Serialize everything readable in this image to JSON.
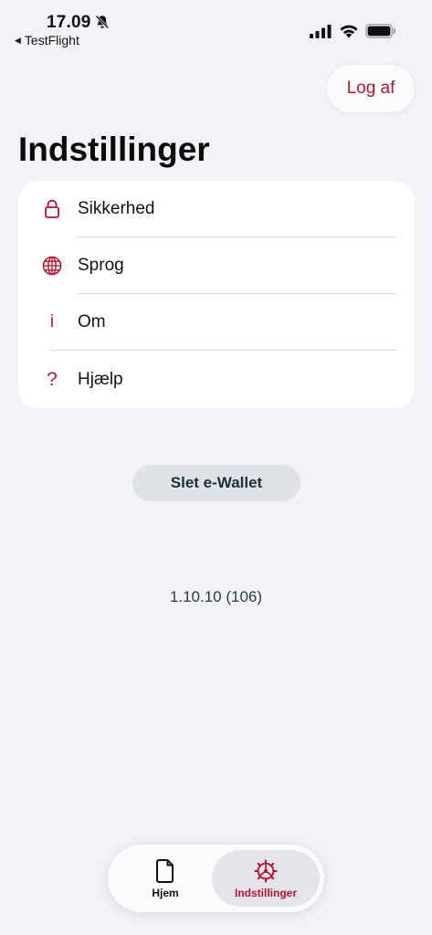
{
  "status_bar": {
    "time": "17.09",
    "back_app": "TestFlight",
    "back_arrow": "◀"
  },
  "header": {
    "logout_label": "Log af",
    "title": "Indstillinger"
  },
  "settings": {
    "items": [
      {
        "label": "Sikkerhed",
        "icon": "lock-icon"
      },
      {
        "label": "Sprog",
        "icon": "globe-icon"
      },
      {
        "label": "Om",
        "icon": "info-icon",
        "glyph": "i"
      },
      {
        "label": "Hjælp",
        "icon": "question-icon",
        "glyph": "?"
      }
    ]
  },
  "actions": {
    "delete_wallet_label": "Slet e-Wallet"
  },
  "app": {
    "version": "1.10.10 (106)"
  },
  "tab_bar": {
    "tabs": [
      {
        "label": "Hjem",
        "icon": "document-icon",
        "active": false
      },
      {
        "label": "Indstillinger",
        "icon": "gear-icon",
        "active": true
      }
    ]
  },
  "colors": {
    "accent": "#b3152f",
    "background": "#f2f2f7",
    "card": "#ffffff",
    "secondary_button": "#dfe3e8"
  }
}
